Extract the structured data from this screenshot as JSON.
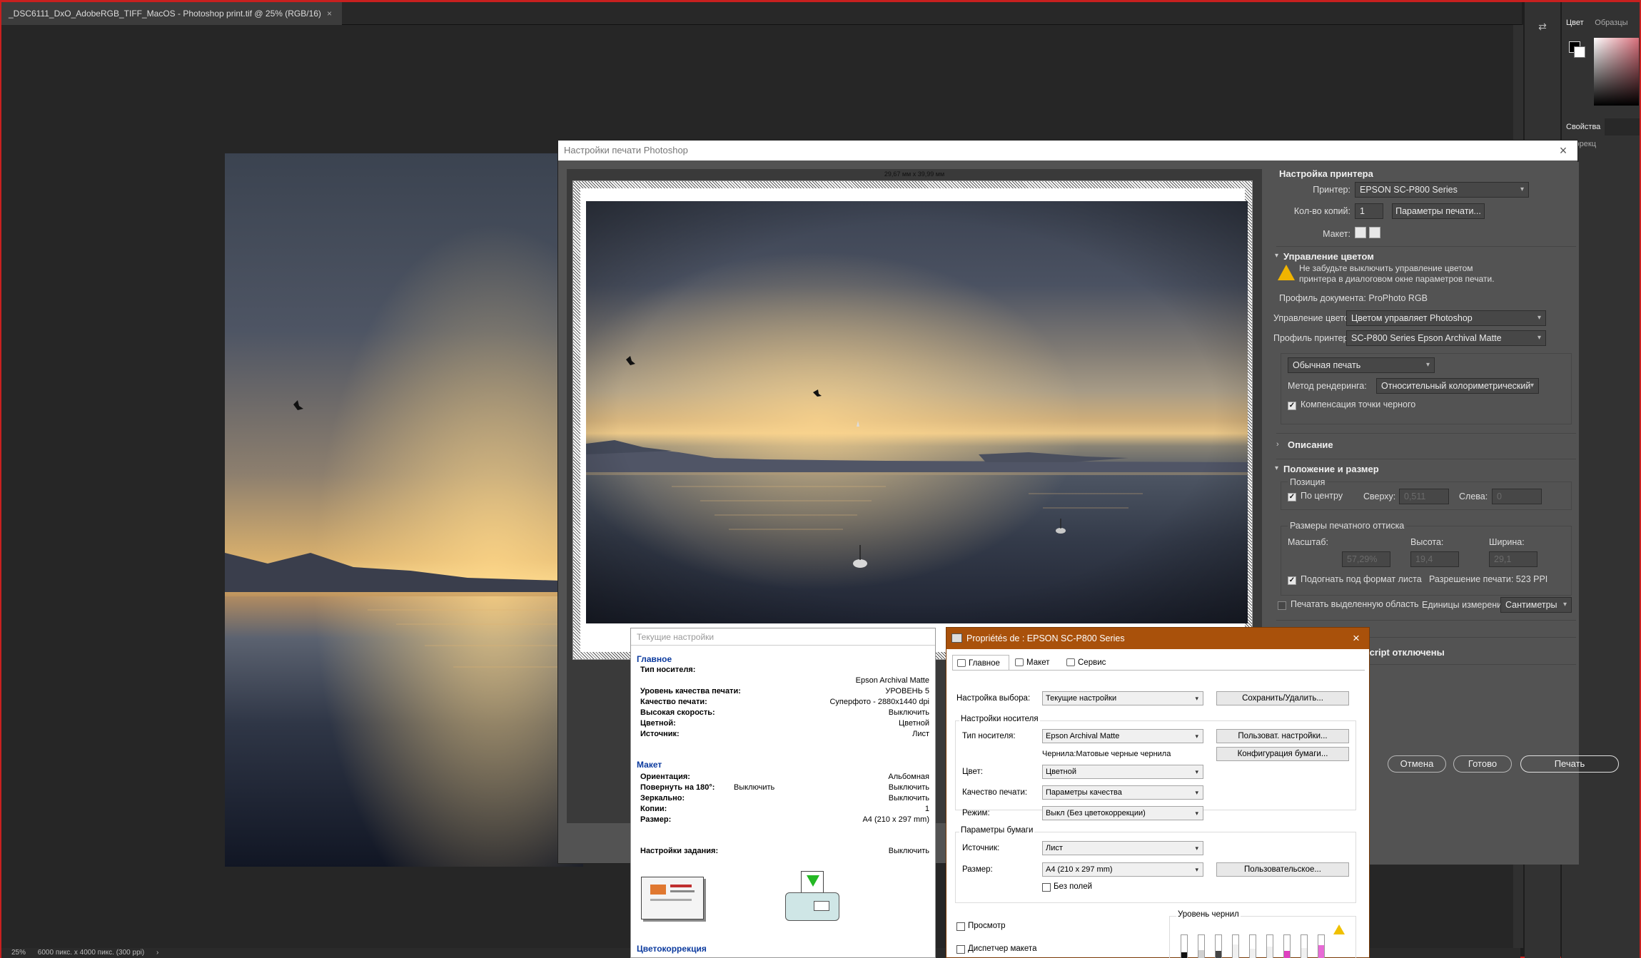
{
  "document": {
    "tab_title": "_DSC6111_DxO_AdobeRGB_TIFF_MacOS - Photoshop print.tif @ 25% (RGB/16)",
    "tab_close": "×",
    "status_zoom": "25%",
    "status_info": "6000 пикс. x 4000 пикс. (300 ppi)",
    "status_arrow": "›"
  },
  "right_panels": {
    "color_tab": "Цвет",
    "swatches_tab": "Образцы",
    "properties_tab": "Свойства",
    "corrections_tab": "Коррекц"
  },
  "print_dialog": {
    "title": "Настройки печати Photoshop",
    "close": "×",
    "dimensions_label": "29,67 мм x 39,99 мм",
    "printer_setup": {
      "title": "Настройка принтера",
      "printer_label": "Принтер:",
      "printer_value": "EPSON SC-P800 Series",
      "copies_label": "Кол-во копий:",
      "copies_value": "1",
      "print_params_button": "Параметры печати...",
      "layout_label": "Макет:"
    },
    "color_management": {
      "title": "Управление цветом",
      "warning": "Не забудьте выключить управление цветом принтера в диалоговом окне параметров печати.",
      "warning_line1": "Не забудьте выключить управление цветом",
      "warning_line2": "принтера в диалоговом окне параметров печати.",
      "doc_profile": "Профиль документа: ProPhoto RGB",
      "handling_label": "Управление цветом:",
      "handling_value": "Цветом управляет Photoshop",
      "printer_profile_label": "Профиль принтера:",
      "printer_profile_value": "SC-P800 Series Epson Archival Matte",
      "print_mode_value": "Обычная печать",
      "rendering_label": "Метод рендеринга:",
      "rendering_value": "Относительный колориметрический",
      "black_point_label": "Компенсация точки черного"
    },
    "description_title": "Описание",
    "position_size": {
      "title": "Положение и размер",
      "position_label": "Позиция",
      "center_label": "По центру",
      "top_label": "Сверху:",
      "top_value": "0,511",
      "left_label": "Слева:",
      "left_value": "0",
      "print_size_label": "Размеры печатного оттиска",
      "scale_label": "Масштаб:",
      "scale_value": "57,29%",
      "height_label": "Высота:",
      "height_value": "19,4",
      "width_label": "Ширина:",
      "width_value": "29,1",
      "fit_label": "Подогнать под формат листа",
      "resolution_text": "Разрешение печати: 523 PPI",
      "print_selection_label": "Печатать выделенную область",
      "units_label": "Единицы измерения:",
      "units_value": "Сантиметры"
    },
    "scripts_text": "Script отключены",
    "buttons": {
      "cancel": "Отмена",
      "done": "Готово",
      "print": "Печать"
    }
  },
  "current_settings": {
    "title": "Текущие настройки",
    "main_heading": "Главное",
    "main_rows": [
      {
        "key": "Тип носителя:",
        "value": ""
      },
      {
        "key": "",
        "value": "Epson Archival Matte"
      },
      {
        "key": "Уровень качества печати:",
        "value": "УРОВЕНЬ 5"
      },
      {
        "key": "Качество печати:",
        "value": "Суперфото - 2880x1440 dpi"
      },
      {
        "key": "Высокая скорость:",
        "value": "Выключить"
      },
      {
        "key": "Цветной:",
        "value": "Цветной"
      },
      {
        "key": "Источник:",
        "value": "Лист"
      }
    ],
    "layout_heading": "Макет",
    "layout_rows": [
      {
        "key": "Ориентация:",
        "value": "Альбомная"
      },
      {
        "key": "Повернуть на 180°:",
        "value": "Выключить"
      },
      {
        "key": "Зеркально:",
        "value": "Выключить"
      },
      {
        "key": "Копии:",
        "value": "1"
      },
      {
        "key": "Размер:",
        "value": "A4 (210 x 297 mm)"
      }
    ],
    "rotate_mid": "Выключить",
    "job_settings_key": "Настройки задания:",
    "job_settings_value": "Выключить",
    "color_heading": "Цветокоррекция"
  },
  "epson_dialog": {
    "title": "Propriétés de : EPSON SC-P800 Series",
    "close": "×",
    "tabs": [
      "Главное",
      "Макет",
      "Сервис"
    ],
    "select_settings_label": "Настройка выбора:",
    "select_settings_value": "Текущие настройки",
    "save_delete_button": "Сохранить/Удалить...",
    "media_group": "Настройки носителя",
    "media_type_label": "Тип носителя:",
    "media_type_value": "Epson Archival Matte",
    "user_settings_button": "Пользоват. настройки...",
    "ink_text": "Чернила:Матовые черные чернила",
    "paper_config_button": "Конфигурация бумаги...",
    "color_label": "Цвет:",
    "color_value": "Цветной",
    "quality_label": "Качество печати:",
    "quality_value": "Параметры качества",
    "mode_label": "Режим:",
    "mode_value": "Выкл (Без цветокоррекции)",
    "paper_group": "Параметры бумаги",
    "source_label": "Источник:",
    "source_value": "Лист",
    "size_label": "Размер:",
    "size_value": "A4 (210 x 297 mm)",
    "custom_button": "Пользовательское...",
    "borderless_label": "Без полей",
    "preview_label": "Просмотр",
    "layout_manager_label": "Диспетчер макета",
    "ink_levels_label": "Уровень чернил",
    "ink_levels": [
      0.25,
      0.35,
      0.3,
      0.6,
      0.4,
      0.5,
      0.3,
      0.45,
      0.55
    ],
    "ink_colors": [
      "#111111",
      "#d0d0d0",
      "#444444",
      "#f0f0f0",
      "#f0f0f0",
      "#f0f0f0",
      "#e040c0",
      "#f0f0f0",
      "#e86ad6"
    ]
  }
}
